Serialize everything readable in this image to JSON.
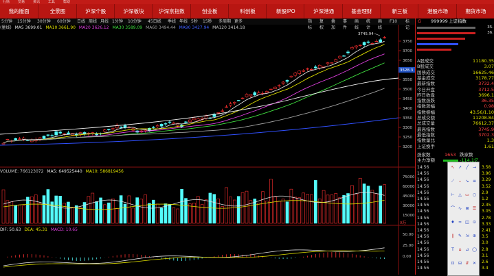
{
  "topbar": {
    "items": [
      "行情",
      "交易",
      "资讯",
      "工具",
      "帮助"
    ]
  },
  "nav": [
    "我的版面",
    "全景图",
    "沪深个股",
    "沪深板块",
    "沪深京指数",
    "创业板",
    "科创板",
    "新股IPO",
    "沪深港通",
    "基金理财",
    "新三板",
    "港股市场",
    "期货市场"
  ],
  "periods": [
    "5分钟",
    "15分钟",
    "30分钟",
    "60分钟",
    "日线",
    "周线",
    "月线",
    "1分钟",
    "10分钟",
    "45日线",
    "季线",
    "年线",
    "5秒",
    "15秒",
    "多周期",
    "更多"
  ],
  "right_tabs": [
    "指标",
    "复权",
    "叠加",
    "事件",
    "画线",
    "统计",
    "画线",
    "F10",
    "标记"
  ],
  "ma_legend": {
    "name": "(量线)",
    "ma5": "MA5 3699.01",
    "ma10": "MA10 3661.90",
    "ma20": "MA20 3626.12",
    "ma30": "MA30 3589.09",
    "ma60": "MA60 3494.44",
    "ma90": "MA90 3427.94",
    "ma120": "MA120 3414.18"
  },
  "price_axis": [
    "3750",
    "3700",
    "3650",
    "3600",
    "3550",
    "3500",
    "3450",
    "3400",
    "3350",
    "3300",
    "3250",
    "3200"
  ],
  "price_marker": "3528.3",
  "high_label": "3745.94",
  "volume_legend": {
    "name": "VOLUME: 766123072",
    "ma5": "MA5: 649525440",
    "ma10": "MA10: 586819456"
  },
  "volume_axis": [
    "75000",
    "60000",
    "45000",
    "30000",
    "15000"
  ],
  "volume_unit": "X万",
  "macd_legend": {
    "name": "DIF: 50.63",
    "dea": "DEA: 45.31",
    "macd": "MACD: 10.65"
  },
  "macd_axis": [
    "50.00",
    "25.00",
    "0.00"
  ],
  "panel": {
    "code": "999999",
    "name": "上证指数",
    "flag": "G",
    "small_vals": [
      "35.",
      "36."
    ],
    "rows": [
      {
        "label": "A股成交",
        "value": "11180.35"
      },
      {
        "label": "B股成交",
        "value": "3.07"
      },
      {
        "label": "国债成交",
        "value": "16625.46"
      },
      {
        "label": "基金成交",
        "value": "3178.77"
      },
      {
        "label": "最新指数",
        "value": "3732.4"
      },
      {
        "label": "今日开盘",
        "value": "3712.5"
      },
      {
        "label": "昨日收盘",
        "value": "3696.1"
      },
      {
        "label": "指数涨跌",
        "value": "36.35"
      },
      {
        "label": "指数涨幅",
        "value": "0.98"
      },
      {
        "label": "指数振幅",
        "value": "43.56/1.10"
      },
      {
        "label": "总成交额",
        "value": "11208.84"
      },
      {
        "label": "总成交量",
        "value": "76612.37"
      },
      {
        "label": "最高指数",
        "value": "3745.9"
      },
      {
        "label": "最低指数",
        "value": "3702.3"
      },
      {
        "label": "指数量比",
        "value": "1.3"
      },
      {
        "label": "上证换手",
        "value": "1.61"
      }
    ],
    "updown": {
      "up_label": "涨家数",
      "up_value": "1653",
      "down_label": "跌家数"
    },
    "net_inflow": {
      "label": "主力净额",
      "value": "-114.1亿"
    },
    "ticks": [
      {
        "time": "14:56",
        "v": "3.58"
      },
      {
        "time": "14:56",
        "v": "3.96"
      },
      {
        "time": "14:56",
        "v": "3.29"
      },
      {
        "time": "14:56",
        "v": "3.52"
      },
      {
        "time": "14:56",
        "v": "2.9"
      },
      {
        "time": "14:56",
        "v": "1.2"
      },
      {
        "time": "14:56",
        "v": "2.35"
      },
      {
        "time": "14:56",
        "v": "3.05"
      },
      {
        "time": "14:56",
        "v": "2.78"
      },
      {
        "time": "14:56",
        "v": "3.33"
      },
      {
        "time": "14:56",
        "v": "2.41"
      },
      {
        "time": "14:56",
        "v": "3.5"
      },
      {
        "time": "14:56",
        "v": "3.0"
      },
      {
        "time": "14:56",
        "v": "2.8"
      },
      {
        "time": "14:56",
        "v": "3.1"
      },
      {
        "time": "14:56",
        "v": "2.6"
      },
      {
        "time": "14:56",
        "v": "3.4"
      }
    ]
  },
  "tool_icons": [
    "↖",
    "↗",
    "╱",
    "→",
    "⟋",
    "⎯",
    "↘",
    "≡",
    "⊢",
    "△",
    "▭",
    "○",
    "⌒",
    "∿",
    "⊞",
    "☰",
    "♦",
    "≈",
    "◫",
    "⊙",
    "∥",
    "✎",
    "⇲",
    "⊕",
    "T",
    "⌂",
    "⊿",
    "◯",
    "⊡",
    "⊟",
    "⇵",
    "✕"
  ]
}
